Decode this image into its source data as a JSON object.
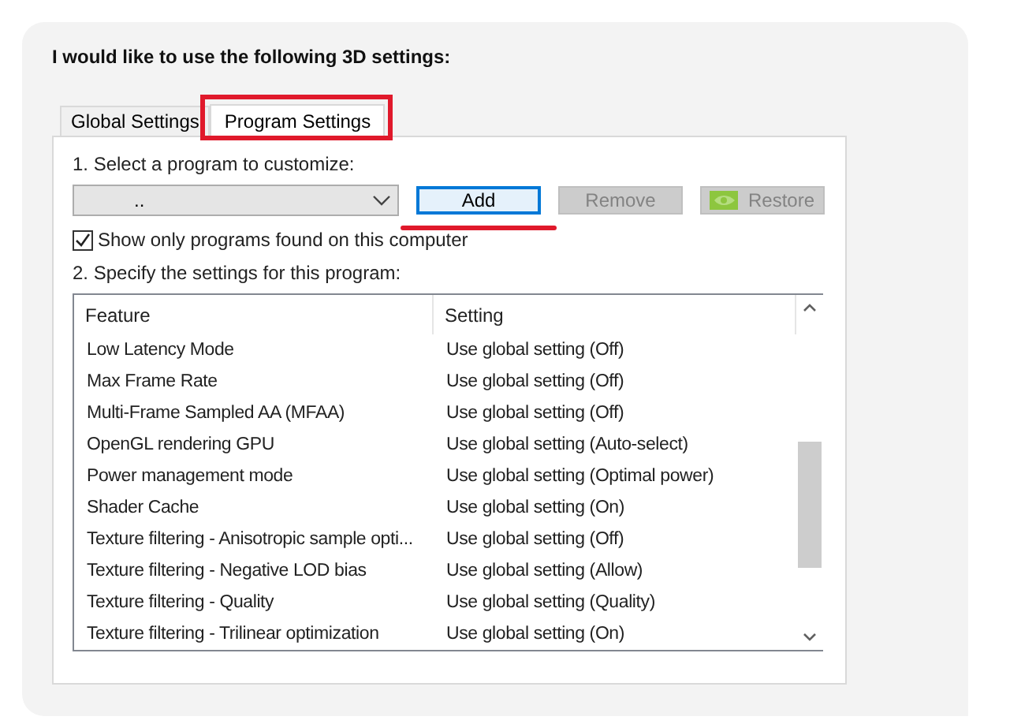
{
  "heading": "I would like to use the following 3D settings:",
  "tabs": [
    {
      "label": "Global Settings",
      "selected": false,
      "highlighted": false
    },
    {
      "label": "Program Settings",
      "selected": true,
      "highlighted": true
    }
  ],
  "program_label": "1. Select a program to customize:",
  "program_dropdown": {
    "value": ".."
  },
  "buttons": [
    {
      "label": "Add",
      "kind": "plain",
      "disabled": false,
      "focused": true,
      "underlined": true
    },
    {
      "label": "Remove",
      "kind": "plain",
      "disabled": true,
      "focused": false,
      "underlined": false
    },
    {
      "label": "Restore",
      "kind": "logo",
      "disabled": true,
      "focused": false,
      "underlined": false
    }
  ],
  "show_only_found": {
    "label": "Show only programs found on this computer",
    "checked": true
  },
  "settings_label": "2. Specify the settings for this program:",
  "table": {
    "columns": [
      "Feature",
      "Setting"
    ],
    "rows": [
      [
        "Low Latency Mode",
        "Use global setting (Off)"
      ],
      [
        "Max Frame Rate",
        "Use global setting (Off)"
      ],
      [
        "Multi-Frame Sampled AA (MFAA)",
        "Use global setting (Off)"
      ],
      [
        "OpenGL rendering GPU",
        "Use global setting (Auto-select)"
      ],
      [
        "Power management mode",
        "Use global setting (Optimal power)"
      ],
      [
        "Shader Cache",
        "Use global setting (On)"
      ],
      [
        "Texture filtering - Anisotropic sample opti...",
        "Use global setting (Off)"
      ],
      [
        "Texture filtering - Negative LOD bias",
        "Use global setting (Allow)"
      ],
      [
        "Texture filtering - Quality",
        "Use global setting (Quality)"
      ],
      [
        "Texture filtering - Trilinear optimization",
        "Use global setting (On)"
      ]
    ]
  }
}
